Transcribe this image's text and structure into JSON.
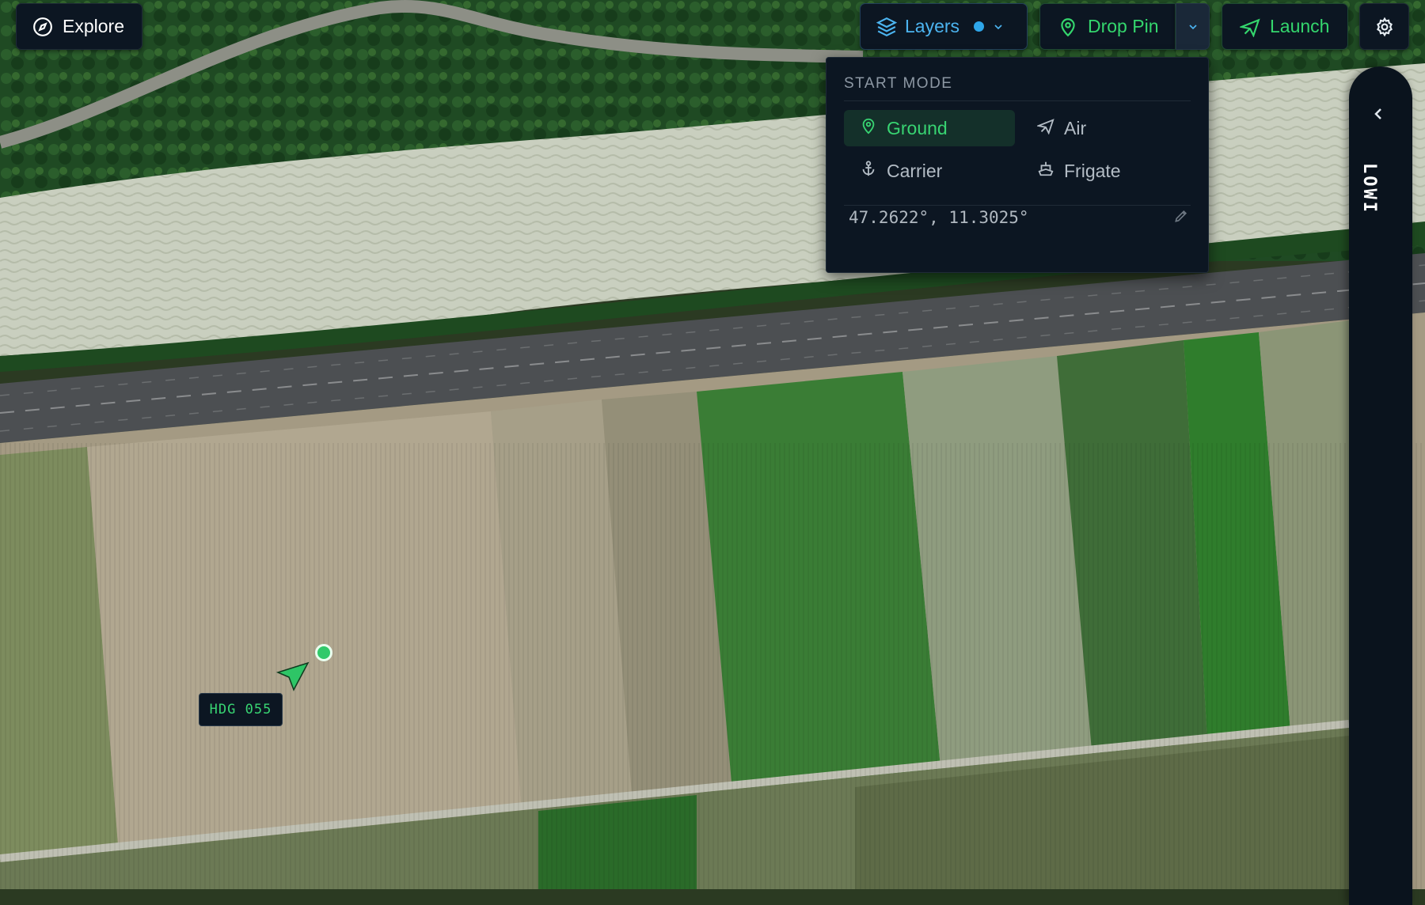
{
  "toolbar": {
    "explore_label": "Explore",
    "layers_label": "Layers",
    "drop_pin_label": "Drop Pin",
    "launch_label": "Launch"
  },
  "start_mode": {
    "title": "START MODE",
    "selected": "Ground",
    "options": [
      {
        "label": "Ground",
        "icon": "map-pin-icon"
      },
      {
        "label": "Air",
        "icon": "plane-icon"
      },
      {
        "label": "Carrier",
        "icon": "anchor-icon"
      },
      {
        "label": "Frigate",
        "icon": "ship-icon"
      }
    ],
    "coordinates": "47.2622°, 11.3025°"
  },
  "map": {
    "heading_label": "HDG 055"
  },
  "side_panel": {
    "label": "LOWI"
  },
  "colors": {
    "accent_green": "#38d472",
    "accent_blue": "#2ea6ea",
    "panel_bg": "#0c1622"
  }
}
